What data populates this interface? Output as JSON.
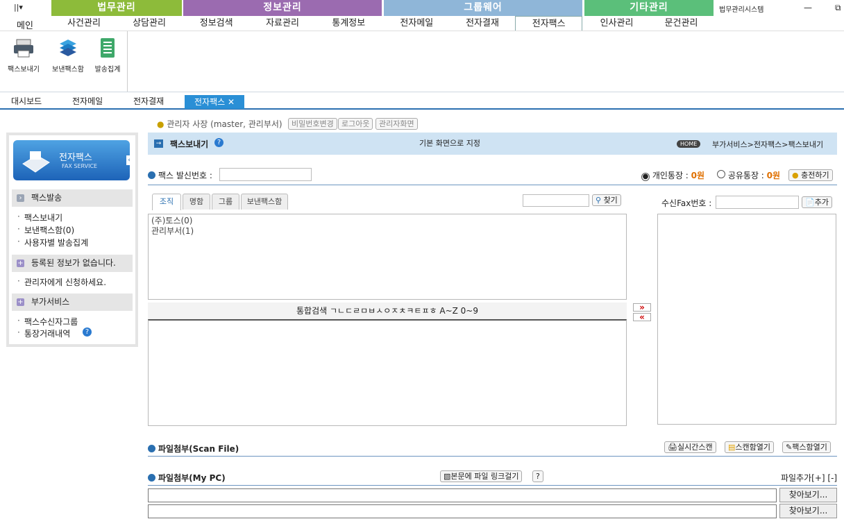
{
  "window": {
    "quick_access": "||▾",
    "right_title": "법무관리시스템",
    "minimize": "—",
    "restore": "⧉"
  },
  "menu": {
    "home": "메인",
    "groups": [
      {
        "title": "법무관리",
        "tabs": [
          "사건관리",
          "상담관리"
        ],
        "color": "#8dbb3a"
      },
      {
        "title": "정보관리",
        "tabs": [
          "정보검색",
          "자료관리",
          "통계정보"
        ],
        "color": "#9b6bb0"
      },
      {
        "title": "그룹웨어",
        "tabs": [
          "전자메일",
          "전자결재",
          "전자팩스"
        ],
        "color": "#8fb6d8"
      },
      {
        "title": "기타관리",
        "tabs": [
          "인사관리",
          "문건관리"
        ],
        "color": "#5bbf7a"
      }
    ]
  },
  "ribbon": {
    "buttons": [
      "팩스보내기",
      "보낸팩스함",
      "발송집계"
    ]
  },
  "doctabs": {
    "items": [
      "대시보드",
      "전자메일",
      "전자결재"
    ],
    "active": "전자팩스 ✕"
  },
  "userbar": {
    "user": "관리자 사장 (master, 관리부서)",
    "btn_pw": "비밀번호변경",
    "btn_logout": "로그아웃",
    "btn_admin": "관리자화면"
  },
  "sidebar": {
    "title": "전자팩스",
    "subtitle": "FAX SERVICE",
    "sec1": "팩스발송",
    "sec1_items": [
      "팩스보내기",
      "보낸팩스함(0)",
      "사용자별 발송집계"
    ],
    "sec2": "등록된 정보가 없습니다.",
    "sec2_items": [
      "관리자에게 신청하세요."
    ],
    "sec3": "부가서비스",
    "sec3_items": [
      "팩스수신자그룹",
      "통장거래내역"
    ]
  },
  "header": {
    "title": "팩스보내기",
    "set_default": "기본 화면으로 지정",
    "home": "HOME",
    "breadcrumb": "부가서비스>전자팩스>팩스보내기"
  },
  "sender": {
    "label": "팩스 발신번호 :",
    "value": "",
    "personal": "개인통장 : ",
    "personal_amt": "0원",
    "shared": "공유통장 : ",
    "shared_amt": "0원",
    "charge": "충전하기"
  },
  "tabs": {
    "items": [
      "조직",
      "명함",
      "그룹",
      "보낸팩스함"
    ],
    "search_btn": "찾기"
  },
  "tree": {
    "items": [
      "(주)토스(0)",
      "관리부서(1)"
    ]
  },
  "unified": {
    "label": "통합검색",
    "letters": "ㄱㄴㄷㄹㅁㅂㅅㅇㅈㅊㅋㅌㅍㅎ",
    "ranges": "A~Z  0~9"
  },
  "recipient": {
    "label": "수신Fax번호 :",
    "add": "추가"
  },
  "move": {
    "right": "»",
    "left": "«"
  },
  "scanfile": {
    "label": "파일첨부(Scan File)",
    "btn1": "실시간스캔",
    "btn2": "스캔함열기",
    "btn3": "팩스함열기"
  },
  "mypc": {
    "label": "파일첨부(My PC)",
    "link_btn": "본문에 파일 링크걸기",
    "help": "?",
    "add": "파일추가[+] [-]",
    "browse": "찾아보기..."
  }
}
